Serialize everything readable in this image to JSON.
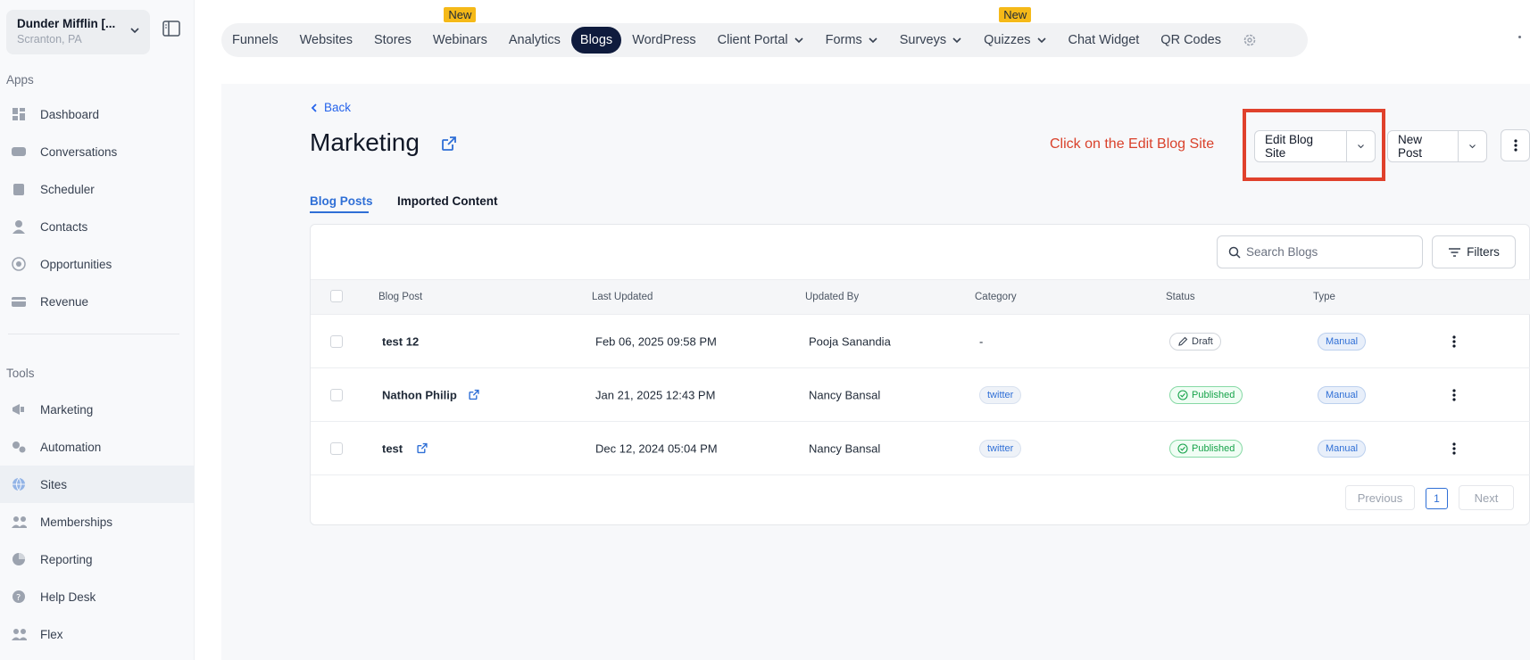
{
  "account": {
    "name": "Dunder Mifflin [...",
    "location": "Scranton, PA"
  },
  "sidebar": {
    "apps_label": "Apps",
    "tools_label": "Tools",
    "apps": [
      {
        "label": "Dashboard",
        "icon": "dashboard-icon"
      },
      {
        "label": "Conversations",
        "icon": "chat-icon"
      },
      {
        "label": "Scheduler",
        "icon": "calendar-icon"
      },
      {
        "label": "Contacts",
        "icon": "person-icon"
      },
      {
        "label": "Opportunities",
        "icon": "target-icon"
      },
      {
        "label": "Revenue",
        "icon": "card-icon"
      }
    ],
    "tools": [
      {
        "label": "Marketing",
        "icon": "megaphone-icon"
      },
      {
        "label": "Automation",
        "icon": "gears-icon"
      },
      {
        "label": "Sites",
        "icon": "globe-icon"
      },
      {
        "label": "Memberships",
        "icon": "people-icon"
      },
      {
        "label": "Reporting",
        "icon": "pie-icon"
      },
      {
        "label": "Help Desk",
        "icon": "help-icon"
      },
      {
        "label": "Flex",
        "icon": "people-icon"
      }
    ]
  },
  "topnav": {
    "new_badge": "New",
    "tabs": [
      {
        "label": "Funnels"
      },
      {
        "label": "Websites"
      },
      {
        "label": "Stores"
      },
      {
        "label": "Webinars",
        "badge": "New"
      },
      {
        "label": "Analytics"
      },
      {
        "label": "Blogs",
        "active": true
      },
      {
        "label": "WordPress"
      },
      {
        "label": "Client Portal",
        "dropdown": true
      },
      {
        "label": "Forms",
        "dropdown": true
      },
      {
        "label": "Surveys",
        "dropdown": true
      },
      {
        "label": "Quizzes",
        "dropdown": true,
        "badge": "New"
      },
      {
        "label": "Chat Widget"
      },
      {
        "label": "QR Codes"
      }
    ]
  },
  "header": {
    "back_label": "Back",
    "title": "Marketing",
    "annotation": "Click on the Edit Blog Site",
    "edit_button": "Edit Blog Site",
    "new_post_button": "New Post"
  },
  "subtabs": {
    "blog_posts": "Blog Posts",
    "imported": "Imported Content"
  },
  "table": {
    "search_placeholder": "Search Blogs",
    "filters_label": "Filters",
    "columns": {
      "blog_post": "Blog Post",
      "last_updated": "Last Updated",
      "updated_by": "Updated By",
      "category": "Category",
      "status": "Status",
      "type": "Type"
    },
    "rows": [
      {
        "title": "test 12",
        "updated": "Feb 06, 2025 09:58 PM",
        "by": "Pooja Sanandia",
        "category": "-",
        "status": "Draft",
        "type": "Manual"
      },
      {
        "title": "Nathon Philip",
        "updated": "Jan 21, 2025 12:43 PM",
        "by": "Nancy Bansal",
        "category": "twitter",
        "status": "Published",
        "type": "Manual"
      },
      {
        "title": "test",
        "updated": "Dec 12, 2024 05:04 PM",
        "by": "Nancy Bansal",
        "category": "twitter",
        "status": "Published",
        "type": "Manual"
      }
    ]
  },
  "pagination": {
    "previous": "Previous",
    "current": "1",
    "next": "Next"
  },
  "colors": {
    "accent": "#2f6fd6",
    "active_tab": "#0f1b3d",
    "annotation": "#d9412b",
    "new_badge": "#f5b918"
  }
}
